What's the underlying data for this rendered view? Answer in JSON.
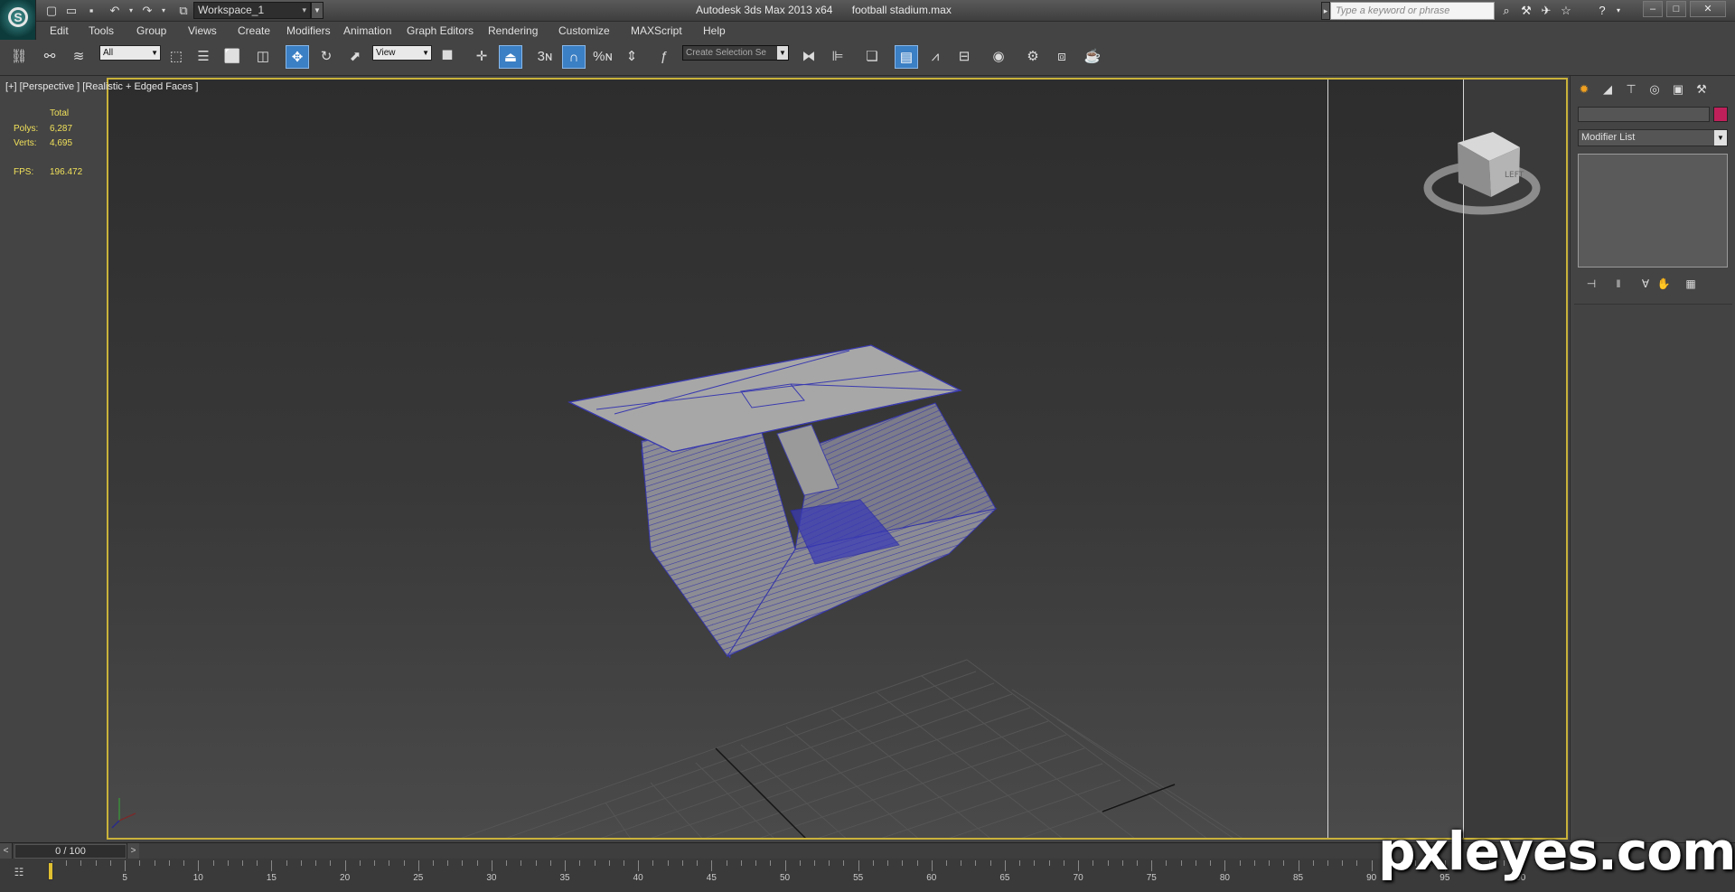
{
  "titlebar": {
    "workspace": "Workspace_1",
    "app_name": "Autodesk 3ds Max  2013 x64",
    "file_name": "football stadium.max",
    "search_placeholder": "Type a keyword or phrase"
  },
  "menu": [
    "Edit",
    "Tools",
    "Group",
    "Views",
    "Create",
    "Modifiers",
    "Animation",
    "Graph Editors",
    "Rendering",
    "Customize",
    "MAXScript",
    "Help"
  ],
  "toolbar": {
    "selection_filter": "All",
    "ref_coord": "View",
    "named_selection": "Create Selection Se",
    "snap_3": "3",
    "percent_snap": "%"
  },
  "viewport": {
    "label": "[+] [Perspective ] [Realistic + Edged Faces ]",
    "stats": {
      "total_label": "Total",
      "polys_label": "Polys:",
      "polys_value": "6,287",
      "verts_label": "Verts:",
      "verts_value": "4,695",
      "fps_label": "FPS:",
      "fps_value": "196.472"
    },
    "viewcube_label": "LEFT"
  },
  "command_panel": {
    "modifier_list": "Modifier List",
    "object_color": "#c0205a"
  },
  "timeline": {
    "frame_display": "0 / 100",
    "ticks": [
      "5",
      "10",
      "15",
      "20",
      "25",
      "30",
      "35",
      "40",
      "45",
      "50",
      "55",
      "60",
      "65",
      "70",
      "75",
      "80",
      "85",
      "90",
      "95",
      "100"
    ]
  },
  "watermark": "pxleyes.com"
}
